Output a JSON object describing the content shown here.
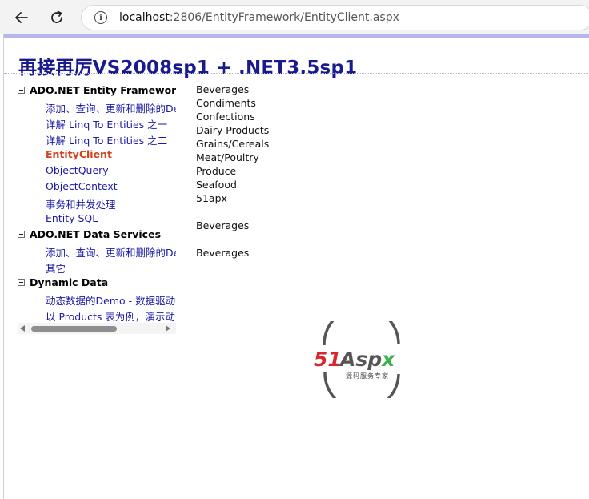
{
  "browser": {
    "url_host": "localhost",
    "url_rest": ":2806/EntityFramework/EntityClient.aspx"
  },
  "page": {
    "title": "再接再厉VS2008sp1 + .NET3.5sp1"
  },
  "tree": {
    "groups": [
      {
        "label": "ADO.NET Entity Framework",
        "items": [
          "添加、查询、更新和删除的De",
          "详解 Linq To Entities 之一",
          "详解 Linq To Entities 之二",
          "EntityClient",
          "ObjectQuery",
          "ObjectContext",
          "事务和并发处理",
          "Entity SQL"
        ],
        "active_index": 3
      },
      {
        "label": "ADO.NET Data Services",
        "items": [
          "添加、查询、更新和删除的De",
          "其它"
        ]
      },
      {
        "label": "Dynamic Data",
        "items": [
          "动态数据的Demo - 数据驱动",
          "以 Products 表为例，演示动"
        ]
      }
    ]
  },
  "categories": {
    "list": [
      "Beverages",
      "Condiments",
      "Confections",
      "Dairy Products",
      "Grains/Cereals",
      "Meat/Poultry",
      "Produce",
      "Seafood",
      "51apx"
    ],
    "result_1": "Beverages",
    "result_2": "Beverages"
  },
  "logo": {
    "text_51": "51",
    "text_aspx": "Aspx",
    "tagline": "源码服务专家",
    "color_red": "#d8262c",
    "color_green": "#3bb14a",
    "color_ring": "#555555"
  }
}
